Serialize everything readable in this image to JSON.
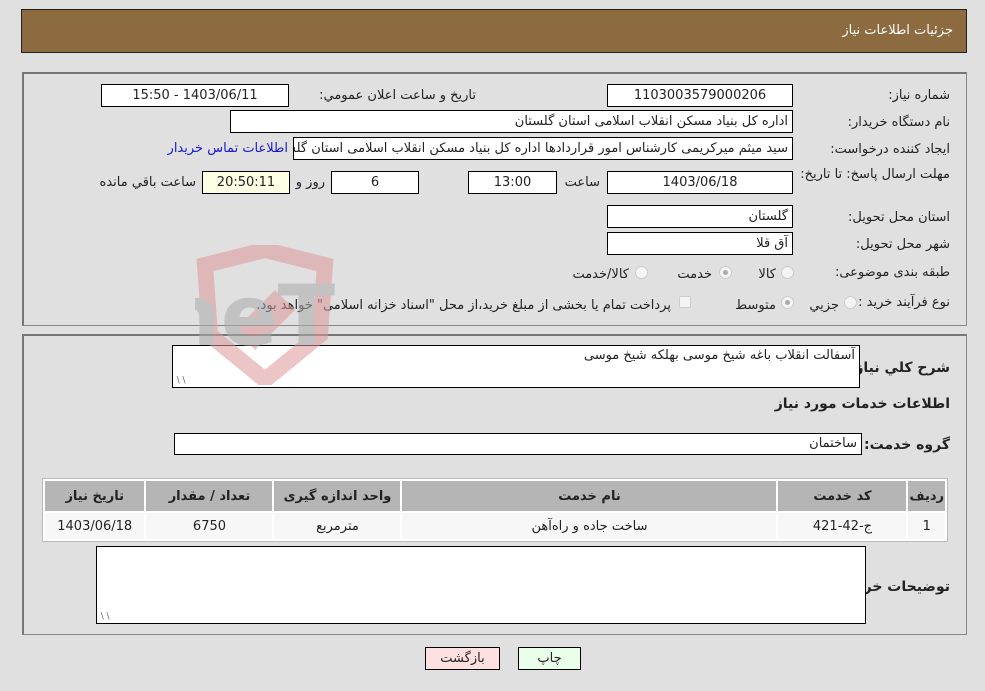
{
  "header": {
    "title": "جزئیات اطلاعات نیاز"
  },
  "details": {
    "need_number_label": "شماره نیاز:",
    "need_number": "1103003579000206",
    "announce_label": "تاريخ و ساعت اعلان عمومي:",
    "announce_value": "1403/06/11 - 15:50",
    "buyer_org_label": "نام دستگاه خريدار:",
    "buyer_org": "اداره کل بنیاد مسکن انقلاب اسلامی استان گلستان",
    "creator_label": "ايجاد کننده درخواست:",
    "creator": "سید میثم میرکریمی کارشناس امور قراردادها اداره کل بنیاد مسکن انقلاب اسلامی استان گلستان",
    "contact_link": "اطلاعات تماس خريدار",
    "deadline_label": "مهلت ارسال پاسخ: تا تاریخ:",
    "deadline_date": "1403/06/18",
    "time_label": "ساعت",
    "deadline_time": "13:00",
    "days_value": "6",
    "days_label": "روز و",
    "remaining_time": "20:50:11",
    "remaining_label": "ساعت باقي مانده",
    "province_label": "استان محل تحويل:",
    "province": "گلستان",
    "city_label": "شهر محل تحويل:",
    "city": "آق قلا",
    "category_label": "طبقه بندی موضوعی:",
    "category_options": [
      {
        "label": "کالا",
        "checked": false
      },
      {
        "label": "خدمت",
        "checked": true
      },
      {
        "label": "کالا/خدمت",
        "checked": false
      }
    ],
    "process_label": "نوع فرآيند خريد :",
    "process_options": [
      {
        "label": "جزيي",
        "checked": false
      },
      {
        "label": "متوسط",
        "checked": true
      }
    ],
    "treasury_note": "پرداخت تمام يا بخشی از مبلغ خريد،از محل \"اسناد خزانه اسلامی\" خواهد بود."
  },
  "need": {
    "description_label": "شرح کلي نياز:",
    "description": "آسفالت انقلاب باغه شیخ موسی بهلکه شیخ موسی",
    "services_heading": "اطلاعات خدمات مورد نياز",
    "service_group_label": "گروه خدمت:",
    "service_group": "ساختمان",
    "table": {
      "headers": [
        "رديف",
        "کد خدمت",
        "نام خدمت",
        "واحد اندازه گيری",
        "تعداد / مقدار",
        "تاريخ نياز"
      ],
      "rows": [
        [
          "1",
          "ج-42-421",
          "ساخت جاده و راه‌آهن",
          "مترمربع",
          "6750",
          "1403/06/18"
        ]
      ]
    },
    "buyer_notes_label": "توضيحات خريدار:",
    "buyer_notes": ""
  },
  "buttons": {
    "print": "چاپ",
    "back": "بازگشت"
  },
  "watermark": {
    "text": "AriaTender.neT"
  },
  "colors": {
    "header": "#8d6b41",
    "print_btn": "#eaffea",
    "back_btn": "#ffe0e0",
    "link": "#1a1ad0"
  }
}
